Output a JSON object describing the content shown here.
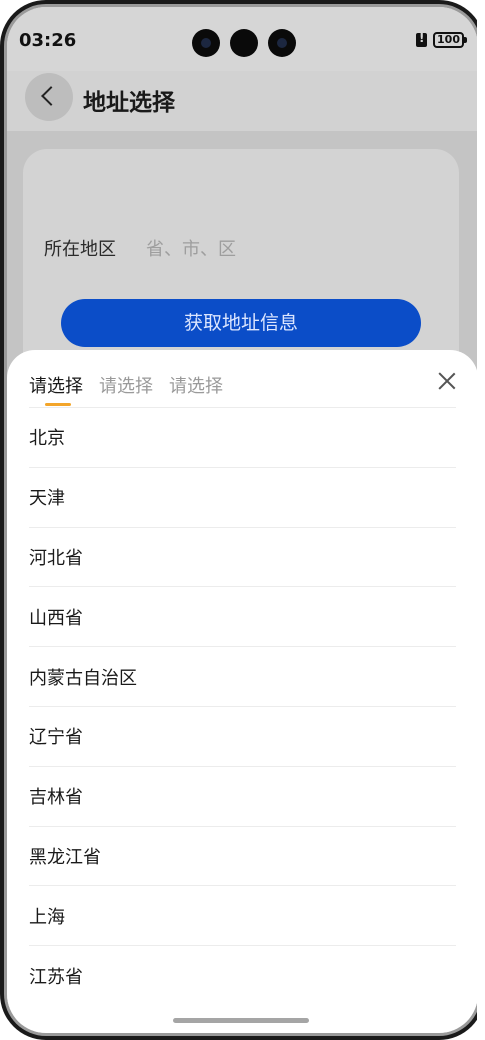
{
  "status_bar": {
    "time": "03:26",
    "battery": "100"
  },
  "header": {
    "title": "地址选择"
  },
  "form": {
    "region_label": "所在地区",
    "region_placeholder": "省、市、区",
    "get_address_button": "获取地址信息"
  },
  "sheet": {
    "tabs": [
      {
        "label": "请选择",
        "active": true
      },
      {
        "label": "请选择",
        "active": false
      },
      {
        "label": "请选择",
        "active": false
      }
    ],
    "items": [
      "北京",
      "天津",
      "河北省",
      "山西省",
      "内蒙古自治区",
      "辽宁省",
      "吉林省",
      "黑龙江省",
      "上海",
      "江苏省"
    ]
  },
  "colors": {
    "accent_button": "#0b4dc8",
    "tab_indicator": "#f3a52a"
  }
}
